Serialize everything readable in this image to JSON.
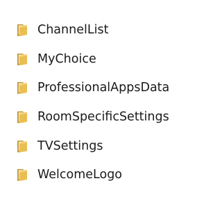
{
  "folders": [
    {
      "name": "ChannelList",
      "icon": "folder-icon"
    },
    {
      "name": "MyChoice",
      "icon": "folder-icon"
    },
    {
      "name": "ProfessionalAppsData",
      "icon": "folder-icon"
    },
    {
      "name": "RoomSpecificSettings",
      "icon": "folder-icon"
    },
    {
      "name": "TVSettings",
      "icon": "folder-icon"
    },
    {
      "name": "WelcomeLogo",
      "icon": "folder-icon"
    }
  ],
  "colors": {
    "folder_front": "#E9BF53",
    "folder_back": "#C9962E",
    "folder_paper": "#FDF6DE",
    "text": "#1A1A1A"
  }
}
